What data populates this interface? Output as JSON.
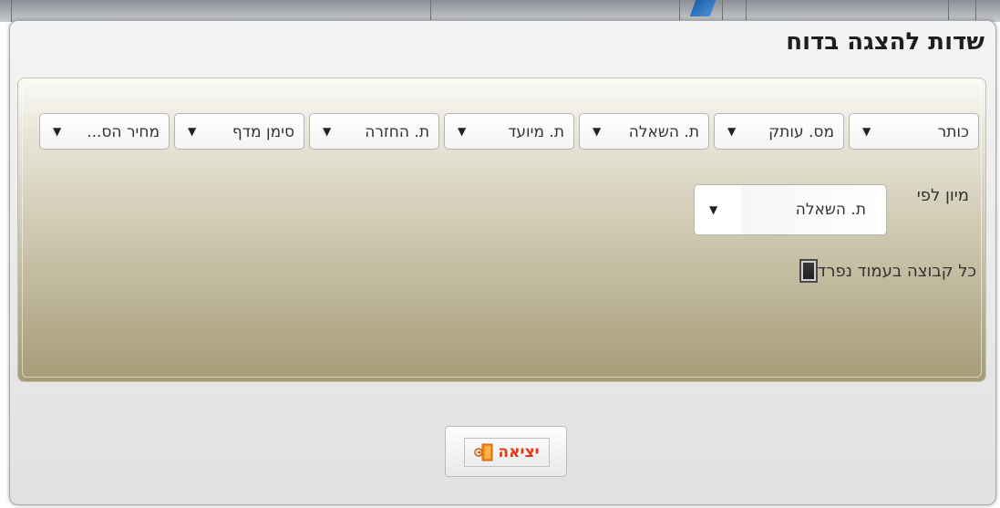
{
  "dialog": {
    "title": "שדות להצגה בדוח"
  },
  "fields": [
    {
      "label": "כותר",
      "arrow": "▼"
    },
    {
      "label": "מס. עותק",
      "arrow": "▼"
    },
    {
      "label": "ת. השאלה",
      "arrow": "▼"
    },
    {
      "label": "ת. מיועד",
      "arrow": "▼"
    },
    {
      "label": "ת. החזרה",
      "arrow": "▼"
    },
    {
      "label": "סימן מדף",
      "arrow": "▼"
    },
    {
      "label": "מחיר הס...",
      "arrow": "▼"
    }
  ],
  "sort": {
    "label": "מיון לפי",
    "value": "ת. השאלה",
    "arrow": "▼"
  },
  "group_page": {
    "label": "כל קבוצה בעמוד נפרד"
  },
  "exit_button": {
    "label": "יציאה",
    "icon": "exit-door-icon"
  },
  "colors": {
    "exit_text": "#e03a1a",
    "panel_top": "#fbfbf7",
    "panel_bottom": "#a49b76"
  }
}
